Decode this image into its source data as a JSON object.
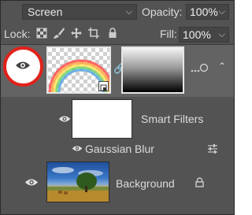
{
  "blend_mode": {
    "value": "Screen"
  },
  "opacity": {
    "label": "Opacity:",
    "value": "100%"
  },
  "lock": {
    "label": "Lock:"
  },
  "fill": {
    "label": "Fill:",
    "value": "100%"
  },
  "layers": [
    {
      "name": "",
      "visible": true,
      "type": "smart-object",
      "has_mask": true
    },
    {
      "name": "Smart Filters",
      "visible": true,
      "type": "smart-filters"
    },
    {
      "name": "Gaussian Blur",
      "visible": true,
      "type": "filter"
    },
    {
      "name": "Background",
      "visible": true,
      "type": "raster",
      "locked": true
    }
  ],
  "colors": {
    "panel": "#535353",
    "selected_row": "#636363",
    "highlight_ring": "#e0221b"
  }
}
